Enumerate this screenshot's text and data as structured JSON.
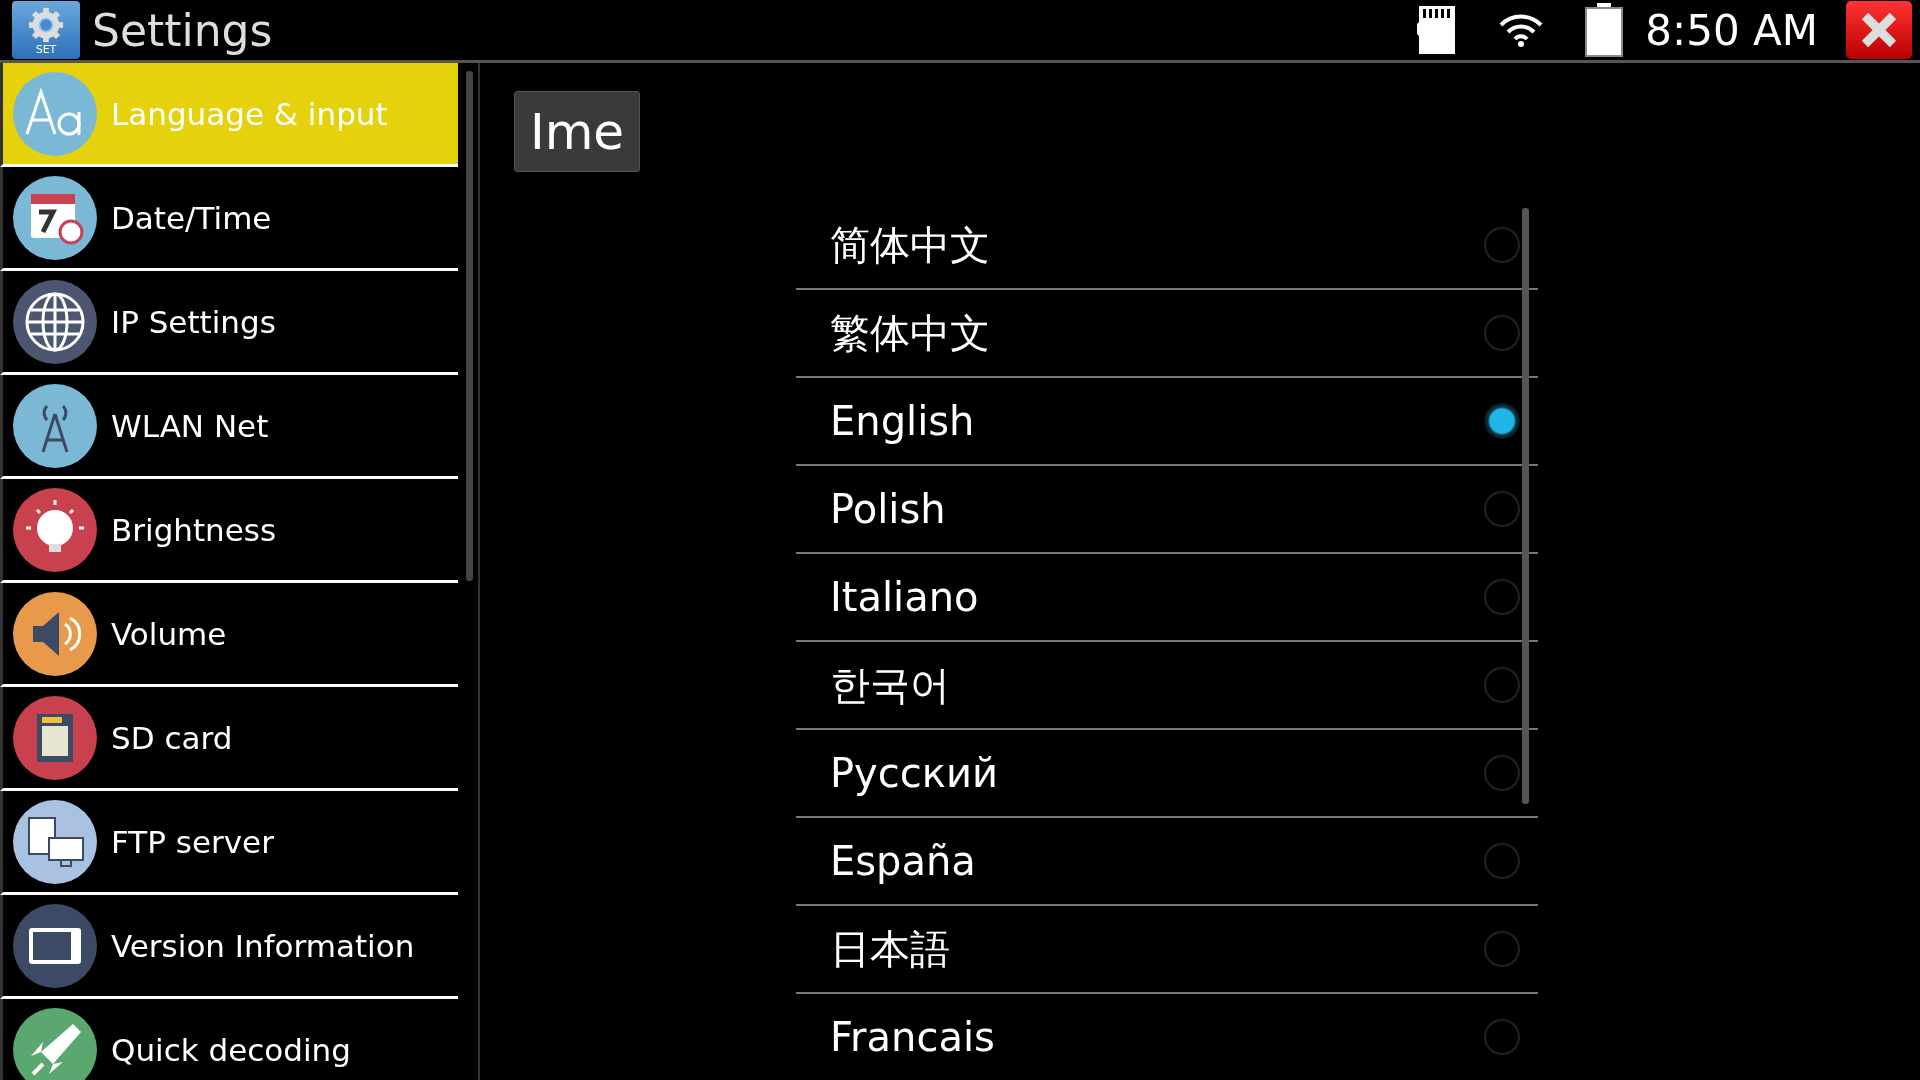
{
  "title_bar": {
    "app_badge": "SET",
    "title": "Settings",
    "time": "8:50 AM"
  },
  "sidebar": {
    "items": [
      {
        "kind": "language",
        "label": "Language & input",
        "selected": true
      },
      {
        "kind": "datetime",
        "label": "Date/Time",
        "selected": false
      },
      {
        "kind": "ip",
        "label": "IP Settings",
        "selected": false
      },
      {
        "kind": "wlan",
        "label": "WLAN Net",
        "selected": false
      },
      {
        "kind": "brightness",
        "label": "Brightness",
        "selected": false
      },
      {
        "kind": "volume",
        "label": "Volume",
        "selected": false
      },
      {
        "kind": "sdcard",
        "label": "SD card",
        "selected": false
      },
      {
        "kind": "ftp",
        "label": "FTP server",
        "selected": false
      },
      {
        "kind": "version",
        "label": "Version Information",
        "selected": false
      },
      {
        "kind": "decoding",
        "label": "Quick decoding",
        "selected": false
      }
    ]
  },
  "content": {
    "ime_button": "Ime",
    "languages": [
      {
        "label": "简体中文",
        "selected": false
      },
      {
        "label": "繁体中文",
        "selected": false
      },
      {
        "label": "English",
        "selected": true
      },
      {
        "label": "Polish",
        "selected": false
      },
      {
        "label": "Italiano",
        "selected": false
      },
      {
        "label": "한국어",
        "selected": false
      },
      {
        "label": "Русский",
        "selected": false
      },
      {
        "label": "España",
        "selected": false
      },
      {
        "label": "日本語",
        "selected": false
      },
      {
        "label": "Francais",
        "selected": false
      }
    ]
  }
}
